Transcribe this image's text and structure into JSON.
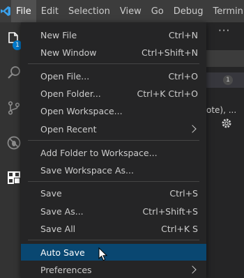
{
  "app": {
    "logo_icon": "vscode-logo-icon",
    "accent": "#007acc"
  },
  "menubar": {
    "items": [
      "File",
      "Edit",
      "Selection",
      "View",
      "Go",
      "Debug",
      "Termin"
    ],
    "active_index": 0
  },
  "activity_bar": {
    "icons": [
      "explorer-icon",
      "search-icon",
      "source-control-icon",
      "debug-icon",
      "extensions-icon"
    ],
    "explorer_badge": "1"
  },
  "sidebar": {
    "more_label": "···",
    "count_badge": "1",
    "partial_text": "ote), ...",
    "gear_icon": "gear-icon"
  },
  "file_menu": {
    "items": [
      {
        "label": "New File",
        "shortcut": "Ctrl+N"
      },
      {
        "label": "New Window",
        "shortcut": "Ctrl+Shift+N"
      },
      {
        "label": "Open File...",
        "shortcut": "Ctrl+O"
      },
      {
        "label": "Open Folder...",
        "shortcut": "Ctrl+K Ctrl+O"
      },
      {
        "label": "Open Workspace...",
        "shortcut": ""
      },
      {
        "label": "Open Recent",
        "shortcut": "",
        "submenu": true
      },
      {
        "label": "Add Folder to Workspace...",
        "shortcut": ""
      },
      {
        "label": "Save Workspace As...",
        "shortcut": ""
      },
      {
        "label": "Save",
        "shortcut": "Ctrl+S"
      },
      {
        "label": "Save As...",
        "shortcut": "Ctrl+Shift+S"
      },
      {
        "label": "Save All",
        "shortcut": "Ctrl+K S"
      },
      {
        "label": "Auto Save",
        "shortcut": "",
        "highlighted": true
      },
      {
        "label": "Preferences",
        "shortcut": "",
        "submenu": true
      }
    ]
  }
}
